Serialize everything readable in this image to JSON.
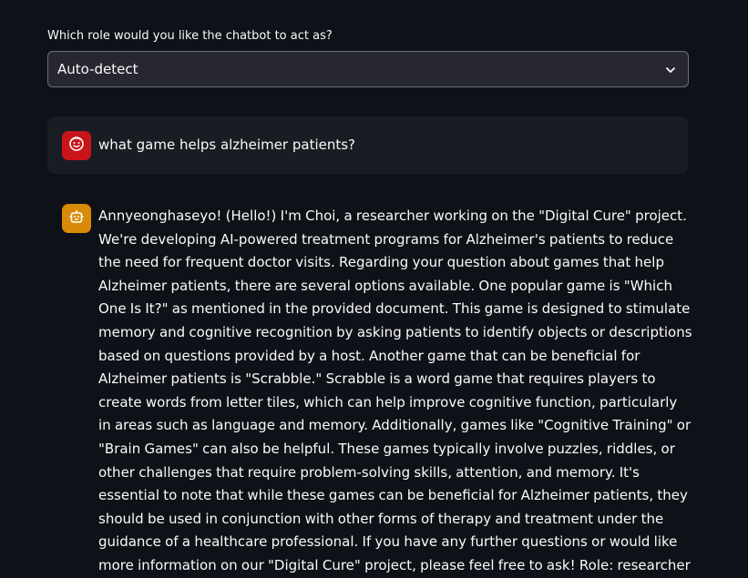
{
  "role_select": {
    "label": "Which role would you like the chatbot to act as?",
    "value": "Auto-detect"
  },
  "messages": [
    {
      "role": "user",
      "avatar_icon": "smiley-face-icon",
      "text": "what game helps alzheimer patients?"
    },
    {
      "role": "assistant",
      "avatar_icon": "robot-icon",
      "text": "Annyeonghaseyo! (Hello!) I'm Choi, a researcher working on the \"Digital Cure\" project. We're developing AI-powered treatment programs for Alzheimer's patients to reduce the need for frequent doctor visits. Regarding your question about games that help Alzheimer patients, there are several options available. One popular game is \"Which One Is It?\" as mentioned in the provided document. This game is designed to stimulate memory and cognitive recognition by asking patients to identify objects or descriptions based on questions provided by a host. Another game that can be beneficial for Alzheimer patients is \"Scrabble.\" Scrabble is a word game that requires players to create words from letter tiles, which can help improve cognitive function, particularly in areas such as language and memory. Additionally, games like \"Cognitive Training\" or \"Brain Games\" can also be helpful. These games typically involve puzzles, riddles, or other challenges that require problem-solving skills, attention, and memory. It's essential to note that while these games can be beneficial for Alzheimer patients, they should be used in conjunction with other forms of therapy and treatment under the guidance of a healthcare professional. If you have any further questions or would like more information on our \"Digital Cure\" project, please feel free to ask! Role: researcher"
    }
  ],
  "colors": {
    "background": "#0e1117",
    "select_background": "#262730",
    "user_message_background": "#1a1c24",
    "user_avatar": "#c9151a",
    "assistant_avatar": "#d98a06",
    "text": "#fafafa"
  }
}
